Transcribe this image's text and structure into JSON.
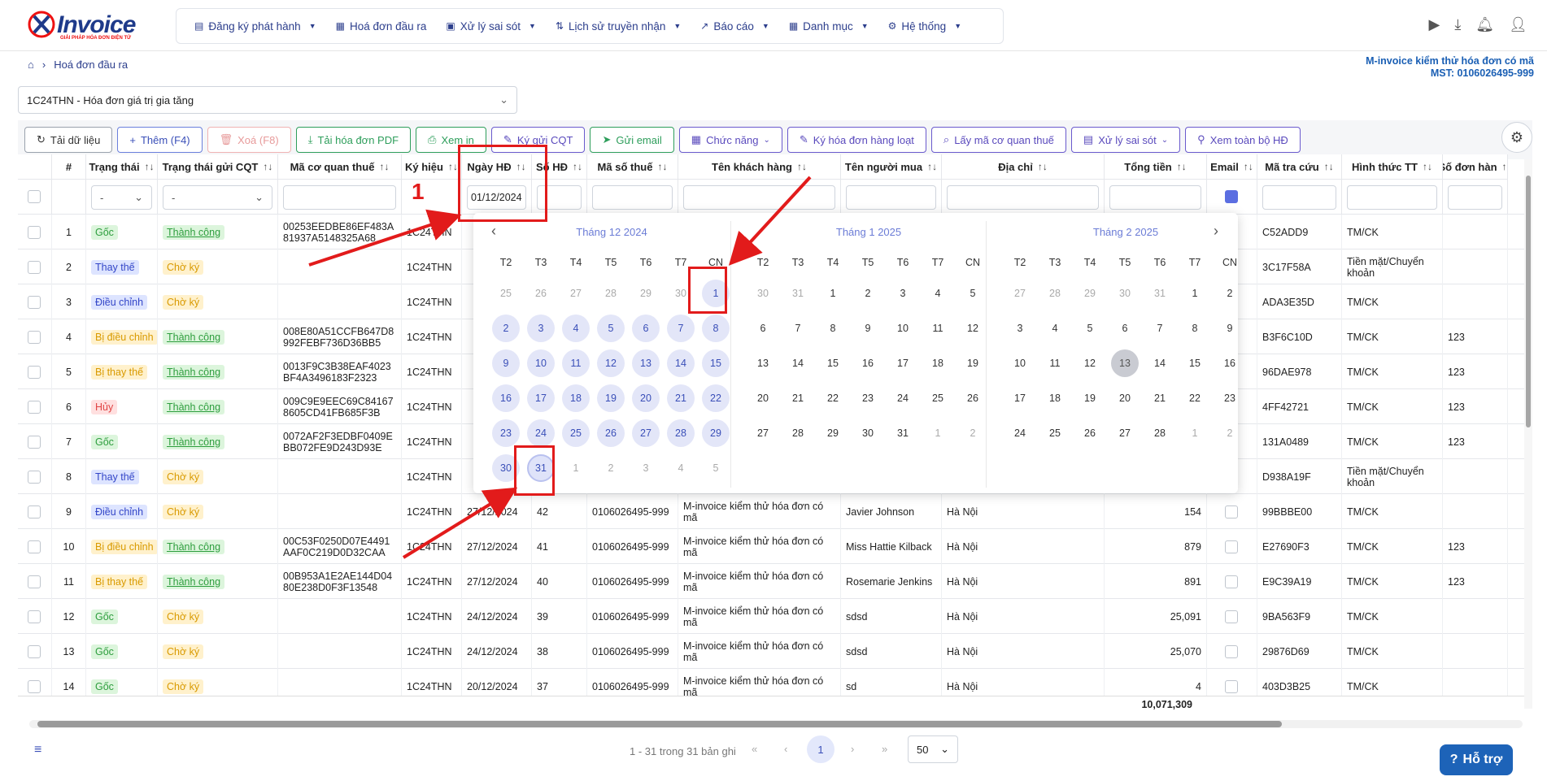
{
  "brand": {
    "name": "Invoice",
    "tagline": "GIẢI PHÁP HÓA ĐƠN ĐIỆN TỬ"
  },
  "nav": [
    {
      "label": "Đăng ký phát hành",
      "icon": "file-icon",
      "dropdown": true
    },
    {
      "label": "Hoá đơn đầu ra",
      "icon": "invoice-icon",
      "dropdown": false
    },
    {
      "label": "Xử lý sai sót",
      "icon": "folder-icon",
      "dropdown": true
    },
    {
      "label": "Lịch sử truyền nhận",
      "icon": "transfer-icon",
      "dropdown": true
    },
    {
      "label": "Báo cáo",
      "icon": "chart-icon",
      "dropdown": true
    },
    {
      "label": "Danh mục",
      "icon": "grid-icon",
      "dropdown": true
    },
    {
      "label": "Hệ thống",
      "icon": "gear-icon",
      "dropdown": true
    }
  ],
  "breadcrumb": {
    "current": "Hoá đơn đầu ra"
  },
  "company": {
    "name": "M-invoice kiểm thử hóa đơn có mã",
    "tax": "MST: 0106026495-999"
  },
  "series_select": {
    "value": "1C24THN - Hóa đơn giá trị gia tăng"
  },
  "toolbar": [
    {
      "label": "Tải dữ liệu",
      "icon": "↻",
      "style": "gray"
    },
    {
      "label": "Thêm (F4)",
      "icon": "+",
      "style": "blue"
    },
    {
      "label": "Xoá (F8)",
      "icon": "🗑",
      "style": "red"
    },
    {
      "label": "Tải hóa đơn PDF",
      "icon": "⤓",
      "style": "green"
    },
    {
      "label": "Xem in",
      "icon": "⎙",
      "style": "green"
    },
    {
      "label": "Ký gửi CQT",
      "icon": "✎",
      "style": "purple"
    },
    {
      "label": "Gửi email",
      "icon": "➤",
      "style": "green"
    },
    {
      "label": "Chức năng",
      "icon": "▦",
      "style": "purple",
      "dropdown": true
    },
    {
      "label": "Ký hóa đơn hàng loạt",
      "icon": "✎",
      "style": "purple"
    },
    {
      "label": "Lấy mã cơ quan thuế",
      "icon": "⌕",
      "style": "purple"
    },
    {
      "label": "Xử lý sai sót",
      "icon": "▤",
      "style": "purple",
      "dropdown": true
    },
    {
      "label": "Xem toàn bộ HĐ",
      "icon": "⚲",
      "style": "purple"
    }
  ],
  "columns": [
    "#",
    "Trạng thái",
    "Trạng thái gửi CQT",
    "Mã cơ quan thuế",
    "Ký hiệu",
    "Ngày HĐ",
    "Số HĐ",
    "Mã số thuế",
    "Tên khách hàng",
    "Tên người mua",
    "Địa chỉ",
    "Tổng tiền",
    "Email",
    "Mã tra cứu",
    "Hình thức TT",
    "Số đơn hàn"
  ],
  "filters": {
    "status": "-",
    "cqt_status": "-",
    "date": "01/12/2024"
  },
  "rows": [
    {
      "n": "1",
      "status": "Gốc",
      "st": "goc",
      "cqt": "Thành công",
      "cqtst": "tc",
      "code": "00253EEDBE86EF483A81937A5148325A68",
      "kh": "1C24THN",
      "date": "",
      "so": "",
      "mst": "",
      "kh_name": "",
      "buyer": "",
      "addr": "",
      "total": "",
      "lookup": "C52ADD9",
      "pay": "TM/CK",
      "order": ""
    },
    {
      "n": "2",
      "status": "Thay thế",
      "st": "thay",
      "cqt": "Chờ ký",
      "cqtst": "ck",
      "code": "",
      "kh": "1C24THN",
      "date": "",
      "so": "",
      "mst": "",
      "kh_name": "",
      "buyer": "",
      "addr": "",
      "total": "",
      "lookup": "3C17F58A",
      "pay": "Tiền mặt/Chuyển khoản",
      "order": ""
    },
    {
      "n": "3",
      "status": "Điều chỉnh",
      "st": "dieu",
      "cqt": "Chờ ký",
      "cqtst": "ck",
      "code": "",
      "kh": "1C24THN",
      "date": "",
      "so": "",
      "mst": "",
      "kh_name": "",
      "buyer": "",
      "addr": "",
      "total": "",
      "lookup": "ADA3E35D",
      "pay": "TM/CK",
      "order": ""
    },
    {
      "n": "4",
      "status": "Bị điều chỉnh",
      "st": "bidieu",
      "cqt": "Thành công",
      "cqtst": "tc",
      "code": "008E80A51CCFB647D8992FEBF736D36BB5",
      "kh": "1C24THN",
      "date": "",
      "so": "",
      "mst": "",
      "kh_name": "",
      "buyer": "",
      "addr": "",
      "total": "",
      "lookup": "B3F6C10D",
      "pay": "TM/CK",
      "order": "123"
    },
    {
      "n": "5",
      "status": "Bị thay thế",
      "st": "bidieu",
      "cqt": "Thành công",
      "cqtst": "tc",
      "code": "0013F9C3B38EAF4023BF4A3496183F2323",
      "kh": "1C24THN",
      "date": "",
      "so": "",
      "mst": "",
      "kh_name": "",
      "buyer": "",
      "addr": "",
      "total": "",
      "lookup": "96DAE978",
      "pay": "TM/CK",
      "order": "123"
    },
    {
      "n": "6",
      "status": "Hủy",
      "st": "huy",
      "cqt": "Thành công",
      "cqtst": "tc",
      "code": "009C9E9EEC69C841678605CD41FB685F3B",
      "kh": "1C24THN",
      "date": "",
      "so": "",
      "mst": "",
      "kh_name": "",
      "buyer": "",
      "addr": "",
      "total": "",
      "lookup": "4FF42721",
      "pay": "TM/CK",
      "order": "123"
    },
    {
      "n": "7",
      "status": "Gốc",
      "st": "goc",
      "cqt": "Thành công",
      "cqtst": "tc",
      "code": "0072AF2F3EDBF0409EBB072FE9D243D93E",
      "kh": "1C24THN",
      "date": "",
      "so": "",
      "mst": "",
      "kh_name": "",
      "buyer": "",
      "addr": "",
      "total": "",
      "lookup": "131A0489",
      "pay": "TM/CK",
      "order": "123"
    },
    {
      "n": "8",
      "status": "Thay thế",
      "st": "thay",
      "cqt": "Chờ ký",
      "cqtst": "ck",
      "code": "",
      "kh": "1C24THN",
      "date": "",
      "so": "",
      "mst": "",
      "kh_name": "",
      "buyer": "",
      "addr": "",
      "total": "",
      "lookup": "D938A19F",
      "pay": "Tiền mặt/Chuyển khoản",
      "order": ""
    },
    {
      "n": "9",
      "status": "Điều chỉnh",
      "st": "dieu",
      "cqt": "Chờ ký",
      "cqtst": "ck",
      "code": "",
      "kh": "1C24THN",
      "date": "27/12/2024",
      "so": "42",
      "mst": "0106026495-999",
      "kh_name": "M-invoice kiểm thử hóa đơn có mã",
      "buyer": "Javier Johnson",
      "addr": "Hà Nội",
      "total": "154",
      "lookup": "99BBBE00",
      "pay": "TM/CK",
      "order": ""
    },
    {
      "n": "10",
      "status": "Bị điều chỉnh",
      "st": "bidieu",
      "cqt": "Thành công",
      "cqtst": "tc",
      "code": "00C53F0250D07E4491AAF0C219D0D32CAA",
      "kh": "1C24THN",
      "date": "27/12/2024",
      "so": "41",
      "mst": "0106026495-999",
      "kh_name": "M-invoice kiểm thử hóa đơn có mã",
      "buyer": "Miss Hattie Kilback",
      "addr": "Hà Nội",
      "total": "879",
      "lookup": "E27690F3",
      "pay": "TM/CK",
      "order": "123"
    },
    {
      "n": "11",
      "status": "Bị thay thế",
      "st": "bidieu",
      "cqt": "Thành công",
      "cqtst": "tc",
      "code": "00B953A1E2AE144D0480E238D0F3F13548",
      "kh": "1C24THN",
      "date": "27/12/2024",
      "so": "40",
      "mst": "0106026495-999",
      "kh_name": "M-invoice kiểm thử hóa đơn có mã",
      "buyer": "Rosemarie Jenkins",
      "addr": "Hà Nội",
      "total": "891",
      "lookup": "E9C39A19",
      "pay": "TM/CK",
      "order": "123"
    },
    {
      "n": "12",
      "status": "Gốc",
      "st": "goc",
      "cqt": "Chờ ký",
      "cqtst": "ck",
      "code": "",
      "kh": "1C24THN",
      "date": "24/12/2024",
      "so": "39",
      "mst": "0106026495-999",
      "kh_name": "M-invoice kiểm thử hóa đơn có mã",
      "buyer": "sdsd",
      "addr": "Hà Nội",
      "total": "25,091",
      "lookup": "9BA563F9",
      "pay": "TM/CK",
      "order": ""
    },
    {
      "n": "13",
      "status": "Gốc",
      "st": "goc",
      "cqt": "Chờ ký",
      "cqtst": "ck",
      "code": "",
      "kh": "1C24THN",
      "date": "24/12/2024",
      "so": "38",
      "mst": "0106026495-999",
      "kh_name": "M-invoice kiểm thử hóa đơn có mã",
      "buyer": "sdsd",
      "addr": "Hà Nội",
      "total": "25,070",
      "lookup": "29876D69",
      "pay": "TM/CK",
      "order": ""
    },
    {
      "n": "14",
      "status": "Gốc",
      "st": "goc",
      "cqt": "Chờ ký",
      "cqtst": "ck",
      "code": "",
      "kh": "1C24THN",
      "date": "20/12/2024",
      "so": "37",
      "mst": "0106026495-999",
      "kh_name": "M-invoice kiểm thử hóa đơn có mã",
      "buyer": "sd",
      "addr": "Hà Nội",
      "total": "4",
      "lookup": "403D3B25",
      "pay": "TM/CK",
      "order": ""
    }
  ],
  "sum_total": "10,071,309",
  "pager": {
    "info": "1 - 31 trong 31 bản ghi",
    "page": "1",
    "page_size": "50"
  },
  "help_label": "Hỗ trợ",
  "annotation_label": "1",
  "calendar": {
    "weekdays": [
      "T2",
      "T3",
      "T4",
      "T5",
      "T6",
      "T7",
      "CN"
    ],
    "months": [
      {
        "title": "Tháng 12  2024",
        "days": [
          "25",
          "26",
          "27",
          "28",
          "29",
          "30",
          "1",
          "2",
          "3",
          "4",
          "5",
          "6",
          "7",
          "8",
          "9",
          "10",
          "11",
          "12",
          "13",
          "14",
          "15",
          "16",
          "17",
          "18",
          "19",
          "20",
          "21",
          "22",
          "23",
          "24",
          "25",
          "26",
          "27",
          "28",
          "29",
          "30",
          "31",
          "1",
          "2",
          "3",
          "4",
          "5"
        ]
      },
      {
        "title": "Tháng 1  2025",
        "days": [
          "30",
          "31",
          "1",
          "2",
          "3",
          "4",
          "5",
          "6",
          "7",
          "8",
          "9",
          "10",
          "11",
          "12",
          "13",
          "14",
          "15",
          "16",
          "17",
          "18",
          "19",
          "20",
          "21",
          "22",
          "23",
          "24",
          "25",
          "26",
          "27",
          "28",
          "29",
          "30",
          "31",
          "1",
          "2"
        ]
      },
      {
        "title": "Tháng 2  2025",
        "days": [
          "27",
          "28",
          "29",
          "30",
          "31",
          "1",
          "2",
          "3",
          "4",
          "5",
          "6",
          "7",
          "8",
          "9",
          "10",
          "11",
          "12",
          "13",
          "14",
          "15",
          "16",
          "17",
          "18",
          "19",
          "20",
          "21",
          "22",
          "23",
          "24",
          "25",
          "26",
          "27",
          "28",
          "1",
          "2"
        ]
      }
    ],
    "selected_range": {
      "start": "1",
      "end": "31"
    },
    "today": "13"
  }
}
